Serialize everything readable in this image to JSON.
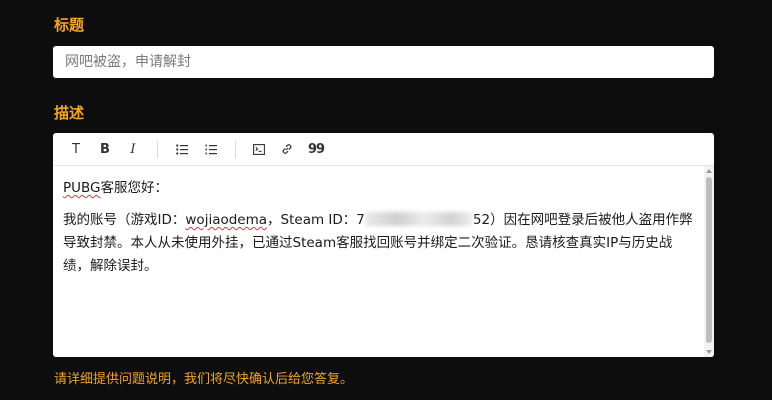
{
  "form": {
    "title_label": "标题",
    "title_placeholder": "网吧被盗，申请解封",
    "description_label": "描述",
    "help_text": "请详细提供问题说明，我们将尽快确认后给您答复。"
  },
  "toolbar": {
    "buttons": [
      {
        "name": "text-style-icon",
        "glyph": "T"
      },
      {
        "name": "bold-icon",
        "glyph": "B"
      },
      {
        "name": "italic-icon",
        "glyph": "I"
      },
      {
        "name": "bullet-list-icon",
        "glyph": "bulleted-list"
      },
      {
        "name": "numbered-list-icon",
        "glyph": "numbered-list"
      },
      {
        "name": "code-block-icon",
        "glyph": "terminal"
      },
      {
        "name": "link-icon",
        "glyph": "link"
      },
      {
        "name": "quote-icon",
        "glyph": "quote"
      }
    ]
  },
  "editor": {
    "greeting_prefix": "PUBG",
    "greeting_suffix": "客服您好：",
    "body_part1": "我的账号（游戏ID：",
    "game_id": "wojiaodema",
    "body_part2": "，Steam ID：7",
    "steam_id_tail": "52",
    "body_part3": "）因在网吧登录后被他人盗用作弊导致封禁。本人从未使用外挂，已通过Steam客服找回账号并绑定二次验证。恳请核查真实IP与历史战绩，解除误封。"
  },
  "colors": {
    "accent": "#f4a51c",
    "background": "#0d0d0d",
    "field_bg": "#ffffff"
  }
}
